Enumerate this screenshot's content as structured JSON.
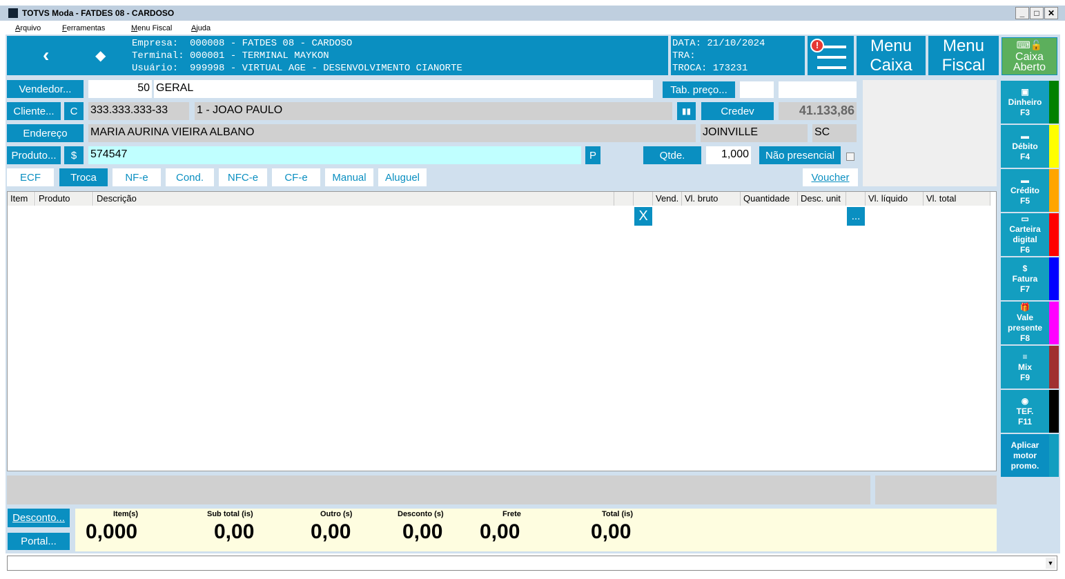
{
  "window": {
    "title": "TOTVS Moda - FATDES 08 - CARDOSO"
  },
  "menu": [
    "Arquivo",
    "Ferramentas",
    "Menu Fiscal",
    "Ajuda"
  ],
  "header": {
    "empresa": "Empresa:  000008 - FATDES 08 - CARDOSO",
    "terminal": "Terminal: 000001 - TERMINAL MAYKON",
    "usuario": "Usuário:  999998 - VIRTUAL AGE - DESENVOLVIMENTO CIANORTE",
    "data": "DATA: 21/10/2024",
    "tra": "TRA:",
    "troca": "TROCA: 173231",
    "menu_caixa": [
      "Menu",
      "Caixa"
    ],
    "menu_fiscal": [
      "Menu",
      "Fiscal"
    ],
    "caixa_status": [
      "Caixa",
      "Aberto"
    ]
  },
  "form": {
    "vendedor_label": "Vendedor...",
    "vendedor_code": "50",
    "vendedor_name": "GERAL",
    "tab_preco_label": "Tab. preço...",
    "cliente_label": "Cliente...",
    "c_label": "C",
    "cpf": "333.333.333-33",
    "cliente_name": "1 - JOAO PAULO",
    "credev_label": "Credev",
    "credev_value": "41.133,86",
    "endereco_label": "Endereço",
    "endereco": "MARIA AURINA VIEIRA ALBANO",
    "cidade": "JOINVILLE",
    "uf": "SC",
    "produto_label": "Produto...",
    "dollar_label": "$",
    "produto": "574547",
    "p_label": "P",
    "qtde_label": "Qtde.",
    "qtde": "1,000",
    "nao_presencial_label": "Não presencial"
  },
  "tabs": [
    "ECF",
    "Troca",
    "NF-e",
    "Cond.",
    "NFC-e",
    "CF-e",
    "Manual",
    "Aluguel"
  ],
  "voucher_label": "Voucher",
  "table": {
    "columns": [
      "Item",
      "Produto",
      "Descrição",
      "",
      "",
      "Vend.",
      "Vl. bruto",
      "Quantidade",
      "Desc. unit",
      "",
      "Vl. líquido",
      "Vl. total"
    ],
    "delete_label": "X",
    "more_label": "..."
  },
  "payments": [
    {
      "label": "Dinheiro",
      "key": "F3",
      "color": "#008000"
    },
    {
      "label": "Débito",
      "key": "F4",
      "color": "#ffff00"
    },
    {
      "label": "Crédito",
      "key": "F5",
      "color": "#ffa500"
    },
    {
      "label": "Carteira digital",
      "key": "F6",
      "color": "#ff0000"
    },
    {
      "label": "Fatura",
      "key": "F7",
      "color": "#0000ff"
    },
    {
      "label": "Vale presente",
      "key": "F8",
      "color": "#ff00ff"
    },
    {
      "label": "Mix",
      "key": "F9",
      "color": "#a03030"
    },
    {
      "label": "TEF.",
      "key": "F11",
      "color": "#000000"
    }
  ],
  "aplicar_label": "Aplicar motor promo.",
  "footer": {
    "desconto_label": "Desconto...",
    "portal_label": "Portal...",
    "totals": [
      {
        "label": "Item(s)",
        "value": "0,000"
      },
      {
        "label": "Sub total (is)",
        "value": "0,00"
      },
      {
        "label": "Outro (s)",
        "value": "0,00"
      },
      {
        "label": "Desconto (s)",
        "value": "0,00"
      },
      {
        "label": "Frete",
        "value": "0,00"
      },
      {
        "label": "Total (is)",
        "value": "0,00"
      }
    ]
  }
}
